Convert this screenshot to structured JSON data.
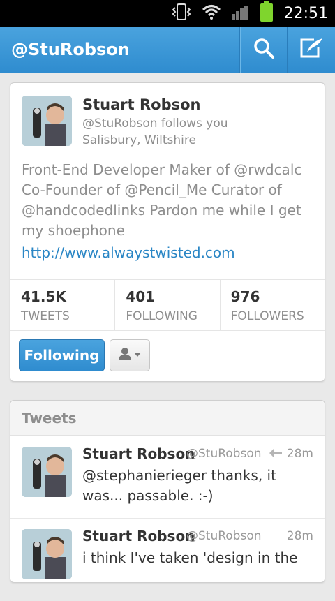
{
  "status_bar": {
    "time": "22:51"
  },
  "action_bar": {
    "title": "@StuRobson"
  },
  "profile": {
    "name": "Stuart Robson",
    "follows_you": "@StuRobson follows you",
    "location": "Salisbury, Wiltshire",
    "bio": "Front-End Developer Maker of @rwdcalc Co-Founder of @Pencil_Me Curator of @handcodedlinks Pardon me while I get my shoephone",
    "url": "http://www.alwaystwisted.com",
    "stats": [
      {
        "value": "41.5K",
        "label": "TWEETS"
      },
      {
        "value": "401",
        "label": "FOLLOWING"
      },
      {
        "value": "976",
        "label": "FOLLOWERS"
      }
    ],
    "following_label": "Following"
  },
  "tweets": {
    "title": "Tweets",
    "items": [
      {
        "name": "Stuart Robson",
        "handle": "@StuRobson",
        "time": "28m",
        "text": "@stephanierieger thanks, it was... passable. :-)"
      },
      {
        "name": "Stuart Robson",
        "handle": "@StuRobson",
        "time": "28m",
        "text": "i think I've taken 'design in the"
      }
    ]
  },
  "colors": {
    "accent": "#2f8ccf",
    "link": "#2a86c5"
  },
  "icons": [
    "vibrate-icon",
    "wifi-icon",
    "signal-icon",
    "battery-icon",
    "search-icon",
    "compose-icon",
    "user-dropdown-icon",
    "reply-icon"
  ]
}
